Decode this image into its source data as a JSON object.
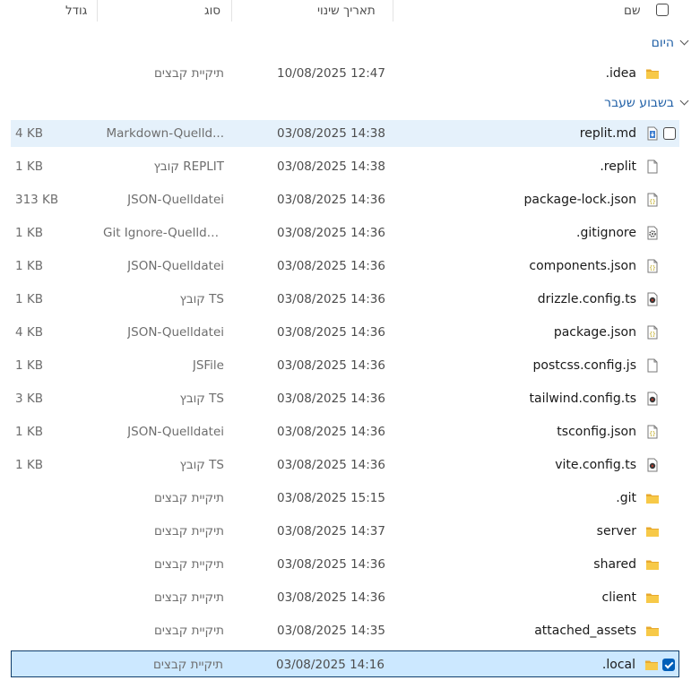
{
  "columns": {
    "name": "שם",
    "date": "תאריך שינוי",
    "type": "סוג",
    "size": "גודל"
  },
  "groups": [
    {
      "label": "היום",
      "rows": [
        {
          "name": ".idea",
          "date": "10/08/2025 12:47",
          "type": "תיקיית קבצים",
          "size": "",
          "icon": "folder-icon"
        }
      ]
    },
    {
      "label": "בשבוע שעבר",
      "rows": [
        {
          "name": "replit.md",
          "date": "03/08/2025 14:38",
          "type": "Markdown-Quelld...",
          "size": "4 KB",
          "icon": "markdown-file-icon"
        },
        {
          "name": ".replit",
          "date": "03/08/2025 14:38",
          "type": "קובץ REPLIT",
          "size": "1 KB",
          "icon": "blank-file-icon"
        },
        {
          "name": "package-lock.json",
          "date": "03/08/2025 14:36",
          "type": "JSON-Quelldatei",
          "size": "313 KB",
          "icon": "json-file-icon"
        },
        {
          "name": ".gitignore",
          "date": "03/08/2025 14:36",
          "type": "Git Ignore-Quellda...",
          "size": "1 KB",
          "icon": "settings-file-icon"
        },
        {
          "name": "components.json",
          "date": "03/08/2025 14:36",
          "type": "JSON-Quelldatei",
          "size": "1 KB",
          "icon": "json-file-icon"
        },
        {
          "name": "drizzle.config.ts",
          "date": "03/08/2025 14:36",
          "type": "קובץ TS",
          "size": "1 KB",
          "icon": "media-file-icon"
        },
        {
          "name": "package.json",
          "date": "03/08/2025 14:36",
          "type": "JSON-Quelldatei",
          "size": "4 KB",
          "icon": "json-file-icon"
        },
        {
          "name": "postcss.config.js",
          "date": "03/08/2025 14:36",
          "type": "JSFile",
          "size": "1 KB",
          "icon": "blank-file-icon"
        },
        {
          "name": "tailwind.config.ts",
          "date": "03/08/2025 14:36",
          "type": "קובץ TS",
          "size": "3 KB",
          "icon": "media-file-icon"
        },
        {
          "name": "tsconfig.json",
          "date": "03/08/2025 14:36",
          "type": "JSON-Quelldatei",
          "size": "1 KB",
          "icon": "json-file-icon"
        },
        {
          "name": "vite.config.ts",
          "date": "03/08/2025 14:36",
          "type": "קובץ TS",
          "size": "1 KB",
          "icon": "media-file-icon"
        },
        {
          "name": ".git",
          "date": "03/08/2025 15:15",
          "type": "תיקיית קבצים",
          "size": "",
          "icon": "folder-icon"
        },
        {
          "name": "server",
          "date": "03/08/2025 14:37",
          "type": "תיקיית קבצים",
          "size": "",
          "icon": "folder-icon"
        },
        {
          "name": "shared",
          "date": "03/08/2025 14:36",
          "type": "תיקיית קבצים",
          "size": "",
          "icon": "folder-icon"
        },
        {
          "name": "client",
          "date": "03/08/2025 14:36",
          "type": "תיקיית קבצים",
          "size": "",
          "icon": "folder-icon"
        },
        {
          "name": "attached_assets",
          "date": "03/08/2025 14:35",
          "type": "תיקיית קבצים",
          "size": "",
          "icon": "folder-icon"
        },
        {
          "name": ".local",
          "date": "03/08/2025 14:16",
          "type": "תיקיית קבצים",
          "size": "",
          "icon": "folder-icon"
        }
      ]
    }
  ],
  "state": {
    "hover_row": "replit.md",
    "selected_row": ".local"
  },
  "colors": {
    "accent": "#005fb8",
    "group": "#1f5fa6",
    "selected": "#cce8ff",
    "hover": "#e5f1fb",
    "folder": "#f2c14e"
  }
}
